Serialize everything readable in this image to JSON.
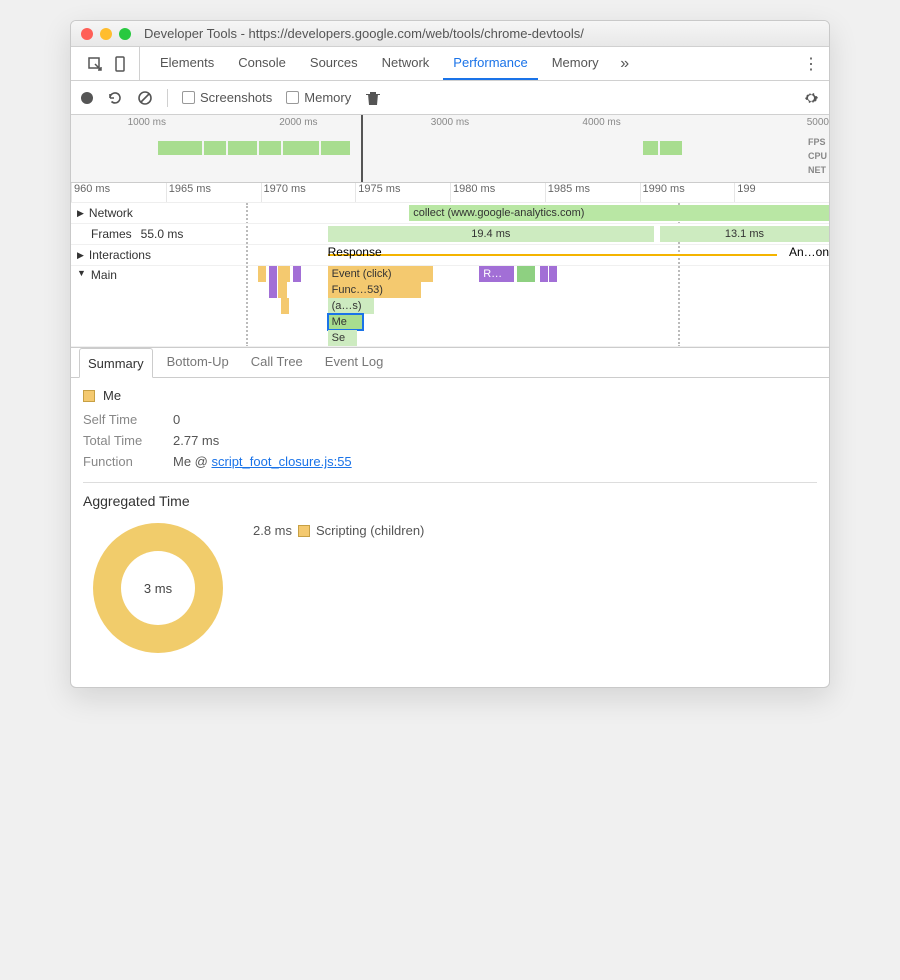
{
  "window": {
    "title": "Developer Tools - https://developers.google.com/web/tools/chrome-devtools/"
  },
  "tabs": {
    "items": [
      "Elements",
      "Console",
      "Sources",
      "Network",
      "Performance",
      "Memory"
    ],
    "active": "Performance",
    "more": "»"
  },
  "toolbar": {
    "screenshots": "Screenshots",
    "memory": "Memory"
  },
  "overview": {
    "ticks": [
      "1000 ms",
      "2000 ms",
      "3000 ms",
      "4000 ms",
      "5000"
    ],
    "lanes": [
      "FPS",
      "CPU",
      "NET"
    ]
  },
  "ruler": {
    "ticks": [
      "960 ms",
      "1965 ms",
      "1970 ms",
      "1975 ms",
      "1980 ms",
      "1985 ms",
      "1990 ms",
      "199"
    ]
  },
  "tracks": {
    "network": {
      "label": "Network",
      "item": "collect (www.google-analytics.com)"
    },
    "frames": {
      "label": "Frames",
      "value": "55.0 ms",
      "f1": "19.4 ms",
      "f2": "13.1 ms"
    },
    "interactions": {
      "label": "Interactions",
      "resp": "Response",
      "anim": "An…on"
    },
    "main": {
      "label": "Main",
      "rows": [
        "Event (click)",
        "Func…53)",
        "(a…s)",
        "Me",
        "Se"
      ],
      "rbar": "R…"
    }
  },
  "subtabs": [
    "Summary",
    "Bottom-Up",
    "Call Tree",
    "Event Log"
  ],
  "summary": {
    "name": "Me",
    "self_k": "Self Time",
    "self_v": "0",
    "total_k": "Total Time",
    "total_v": "2.77 ms",
    "func_k": "Function",
    "func_prefix": "Me @ ",
    "func_link": "script_foot_closure.js:55",
    "agg_title": "Aggregated Time",
    "donut_total": "3 ms",
    "legend_val": "2.8 ms",
    "legend_label": "Scripting (children)"
  },
  "chart_data": {
    "type": "pie",
    "title": "Aggregated Time",
    "total_label": "3 ms",
    "series": [
      {
        "name": "Scripting (children)",
        "value": 2.8,
        "unit": "ms",
        "color": "#f1cc6b"
      }
    ]
  }
}
